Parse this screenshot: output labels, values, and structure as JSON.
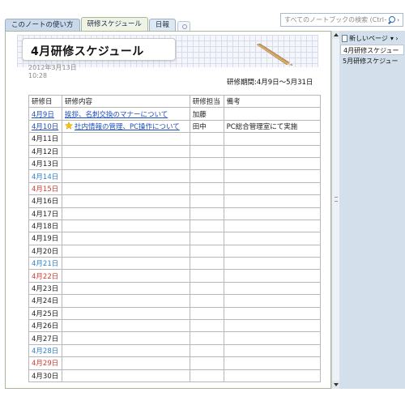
{
  "tabs": [
    {
      "label": "このノートの使い方"
    },
    {
      "label": "研修スケジュール"
    },
    {
      "label": "日報"
    }
  ],
  "search": {
    "placeholder": "すべてのノートブックの検索 (Ctrl+E)"
  },
  "page": {
    "title": "4月研修スケジュール",
    "date": "2012年3月13日",
    "time": "10:28",
    "period": "研修期間:4月9日～5月31日"
  },
  "table": {
    "headers": [
      "研修日",
      "研修内容",
      "研修担当",
      "備考"
    ],
    "rows": [
      {
        "date": "4月9日",
        "content": "挨拶、名刺交換のマナーについて",
        "person": "加藤",
        "note": ""
      },
      {
        "date": "4月10日",
        "content": "社内情報の管理、PC操作について",
        "person": "田中",
        "note": "PC総合管理室にて実施"
      },
      {
        "date": "4月11日",
        "content": "",
        "person": "",
        "note": ""
      },
      {
        "date": "4月12日",
        "content": "",
        "person": "",
        "note": ""
      },
      {
        "date": "4月13日",
        "content": "",
        "person": "",
        "note": ""
      },
      {
        "date": "4月14日",
        "content": "",
        "person": "",
        "note": ""
      },
      {
        "date": "4月15日",
        "content": "",
        "person": "",
        "note": ""
      },
      {
        "date": "4月16日",
        "content": "",
        "person": "",
        "note": ""
      },
      {
        "date": "4月17日",
        "content": "",
        "person": "",
        "note": ""
      },
      {
        "date": "4月18日",
        "content": "",
        "person": "",
        "note": ""
      },
      {
        "date": "4月19日",
        "content": "",
        "person": "",
        "note": ""
      },
      {
        "date": "4月20日",
        "content": "",
        "person": "",
        "note": ""
      },
      {
        "date": "4月21日",
        "content": "",
        "person": "",
        "note": ""
      },
      {
        "date": "4月22日",
        "content": "",
        "person": "",
        "note": ""
      },
      {
        "date": "4月23日",
        "content": "",
        "person": "",
        "note": ""
      },
      {
        "date": "4月24日",
        "content": "",
        "person": "",
        "note": ""
      },
      {
        "date": "4月25日",
        "content": "",
        "person": "",
        "note": ""
      },
      {
        "date": "4月26日",
        "content": "",
        "person": "",
        "note": ""
      },
      {
        "date": "4月27日",
        "content": "",
        "person": "",
        "note": ""
      },
      {
        "date": "4月28日",
        "content": "",
        "person": "",
        "note": ""
      },
      {
        "date": "4月29日",
        "content": "",
        "person": "",
        "note": ""
      },
      {
        "date": "4月30日",
        "content": "",
        "person": "",
        "note": ""
      }
    ]
  },
  "pages_panel": {
    "new_page_label": "新しいページ",
    "items": [
      "4月研修スケジュー",
      "5月研修スケジュー"
    ]
  },
  "colors": {
    "saturday": "#2f7fce",
    "sunday": "#d23b2b",
    "link": "#1f4fbf"
  },
  "icons": {
    "star": "star-icon",
    "pencil": "pencil-icon",
    "search": "search-icon"
  }
}
